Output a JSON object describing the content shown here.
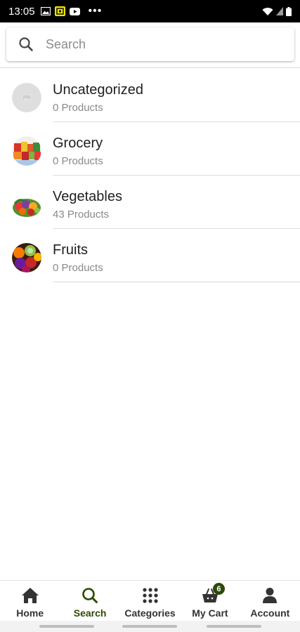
{
  "status_bar": {
    "time": "13:05",
    "dots": "•••"
  },
  "search": {
    "placeholder": "Search"
  },
  "categories": [
    {
      "title": "Uncategorized",
      "subtitle": "0 Products",
      "thumb": "placeholder-image-icon"
    },
    {
      "title": "Grocery",
      "subtitle": "0 Products",
      "thumb": "grocery-image"
    },
    {
      "title": "Vegetables",
      "subtitle": "43 Products",
      "thumb": "vegetables-image"
    },
    {
      "title": "Fruits",
      "subtitle": "0 Products",
      "thumb": "fruits-image"
    }
  ],
  "bottom_nav": {
    "tabs": [
      {
        "label": "Home",
        "icon": "home-icon",
        "active": false
      },
      {
        "label": "Search",
        "icon": "search-icon",
        "active": true
      },
      {
        "label": "Categories",
        "icon": "grid-icon",
        "active": false
      },
      {
        "label": "My Cart",
        "icon": "basket-icon",
        "active": false,
        "badge": "6"
      },
      {
        "label": "Account",
        "icon": "person-icon",
        "active": false
      }
    ]
  },
  "colors": {
    "active": "#2d4a00",
    "badge": "#2b4a08",
    "divider": "#dcdcdc"
  }
}
